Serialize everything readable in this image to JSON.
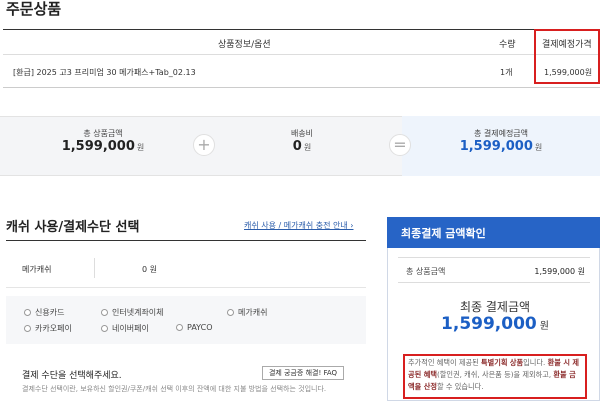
{
  "order": {
    "title": "주문상품",
    "headers": {
      "info": "상품정보/옵션",
      "qty": "수량",
      "price": "결제예정가격"
    },
    "item": {
      "name": "[환급] 2025 고3 프리미엄 30 메가패스+Tab_02.13",
      "qty": "1개",
      "price": "1,599,000원"
    }
  },
  "summary": {
    "total_label": "총 상품금액",
    "total_value": "1,599,000",
    "total_unit": "원",
    "plus": "+",
    "ship_label": "배송비",
    "ship_value": "0",
    "ship_unit": "원",
    "equals": "=",
    "final_label": "총 결제예정금액",
    "final_value": "1,599,000",
    "final_unit": "원"
  },
  "payment": {
    "title": "캐쉬 사용/결제수단 선택",
    "charge_link": "캐쉬 사용 / 메가캐쉬 충전 안내 ›",
    "cash_label": "메가캐쉬",
    "cash_value": "0 원",
    "methods": [
      "신용카드",
      "인터넷계좌이체",
      "메가캐쉬",
      "카카오페이",
      "네이버페이",
      "PAYCO"
    ],
    "guide_title": "결제 수단을 선택해주세요.",
    "faq_button": "결제 궁금증 해결! FAQ",
    "guide_text": "결제수단 선택이란, 보유하신 할인권/쿠폰/캐쉬 선택 이후의 잔액에 대한 지불 방법을 선택하는 것입니다."
  },
  "final_panel": {
    "title": "최종결제 금액확인",
    "total_label": "총 상품금액",
    "total_value": "1,599,000 원",
    "final_label": "최종 결제금액",
    "final_value": "1,599,000",
    "final_unit": "원",
    "notice_1": "추가적인 혜택이 제공된 ",
    "notice_hl1": "특별기획 상품",
    "notice_2": "입니다. ",
    "notice_hl2": "환불 시 제공된 혜택",
    "notice_3": "(할인권, 캐쉬, 사은품 등)을 제외하고, ",
    "notice_hl3": "환불 금액을 산정",
    "notice_4": "할 수 있습니다."
  },
  "colors": {
    "accent": "#2764c6",
    "highlight_box": "#d81f1f",
    "final_amount": "#1c5fc4"
  }
}
